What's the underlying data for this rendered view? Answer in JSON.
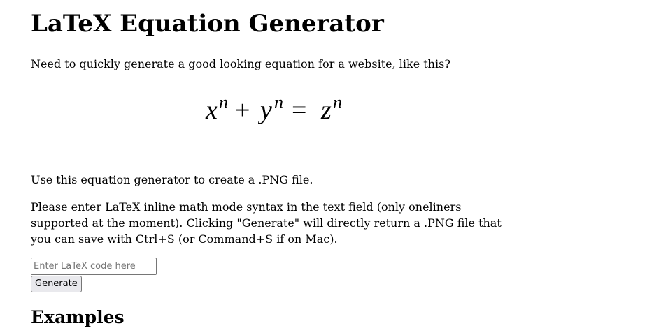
{
  "page": {
    "title": "LaTeX Equation Generator",
    "intro": "Need to quickly generate a good looking equation for a website, like this?",
    "equation": {
      "x": "x",
      "n1": "n",
      "plus": "+",
      "y": "y",
      "n2": "n",
      "equals": "=",
      "z": "z",
      "n3": "n"
    },
    "usage": "Use this equation generator to create a .PNG file.",
    "instructions": "Please enter LaTeX inline math mode syntax in the text field (only oneliners supported at the moment). Clicking \"Generate\" will directly return a .PNG file that you can save with Ctrl+S (or Command+S if on Mac).",
    "input": {
      "placeholder": "Enter LaTeX code here",
      "value": ""
    },
    "generate_label": "Generate",
    "examples_heading": "Examples"
  }
}
